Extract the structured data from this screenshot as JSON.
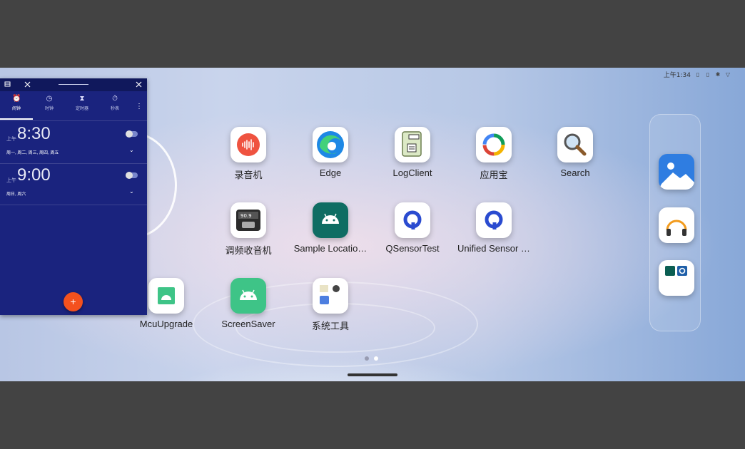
{
  "status_bar": {
    "time": "上午1:34",
    "icons": [
      "sim-icon",
      "sim-icon",
      "bluetooth-icon",
      "wifi-icon"
    ]
  },
  "apps": [
    {
      "name": "recorder",
      "label": "录音机",
      "icon": "sound-wave-icon"
    },
    {
      "name": "edge",
      "label": "Edge",
      "icon": "edge-browser-icon"
    },
    {
      "name": "logclient",
      "label": "LogClient",
      "icon": "log-document-icon"
    },
    {
      "name": "app-store",
      "label": "应用宝",
      "icon": "app-store-icon"
    },
    {
      "name": "search",
      "label": "Search",
      "icon": "magnifier-icon"
    },
    {
      "name": "fm-radio",
      "label": "调频收音机",
      "icon": "radio-icon"
    },
    {
      "name": "sample-location",
      "label": "Sample Locatio…",
      "icon": "android-icon"
    },
    {
      "name": "qsensortest",
      "label": "QSensorTest",
      "icon": "q-logo-icon"
    },
    {
      "name": "unified-sensor",
      "label": "Unified Sensor …",
      "icon": "q-logo-icon"
    },
    {
      "name": "mcuupgrade",
      "label": "McuUpgrade",
      "icon": "android-icon"
    },
    {
      "name": "screensaver",
      "label": "ScreenSaver",
      "icon": "android-icon"
    },
    {
      "name": "system-tools",
      "label": "系统工具",
      "icon": "folder-icon"
    }
  ],
  "dock": [
    "gallery-icon",
    "headphones-icon",
    "settings-folder-icon"
  ],
  "pages": {
    "count": 2,
    "active": 2
  },
  "clock_app": {
    "tabs": [
      {
        "label": "闹钟",
        "icon": "alarm-icon",
        "active": true
      },
      {
        "label": "时钟",
        "icon": "clock-icon",
        "active": false
      },
      {
        "label": "定时器",
        "icon": "hourglass-icon",
        "active": false
      },
      {
        "label": "秒表",
        "icon": "stopwatch-icon",
        "active": false
      }
    ],
    "alarms": [
      {
        "ampm": "上午",
        "time": "8:30",
        "days": "周一, 周二, 周三, 周四, 周五",
        "enabled": false
      },
      {
        "ampm": "上午",
        "time": "9:00",
        "days": "周日, 周六",
        "enabled": false
      }
    ],
    "fab_label": "+"
  }
}
